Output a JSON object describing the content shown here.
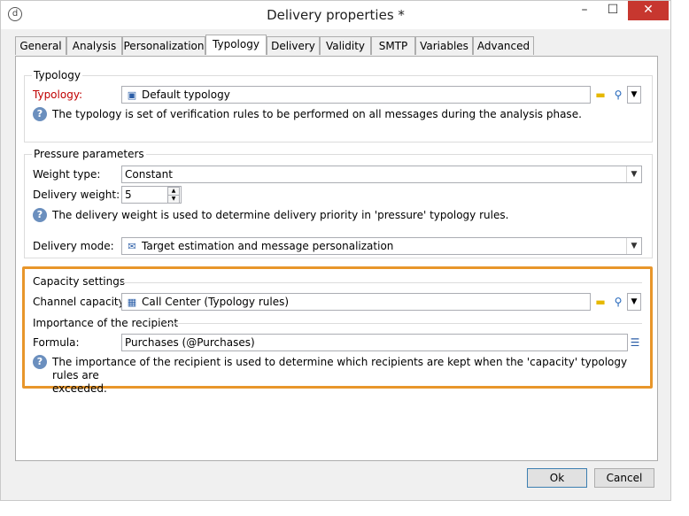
{
  "window": {
    "title": "Delivery properties *",
    "app_icon": "d",
    "min_glyph": "–",
    "max_glyph": "☐",
    "close_glyph": "✕"
  },
  "tabs": [
    {
      "label": "General"
    },
    {
      "label": "Analysis"
    },
    {
      "label": "Personalization"
    },
    {
      "label": "Typology",
      "active": true
    },
    {
      "label": "Delivery"
    },
    {
      "label": "Validity"
    },
    {
      "label": "SMTP"
    },
    {
      "label": "Variables"
    },
    {
      "label": "Advanced"
    }
  ],
  "typology_group": {
    "title": "Typology",
    "label": "Typology:",
    "value": "Default typology",
    "help": "The typology is set of verification rules to be performed on all messages during the analysis phase."
  },
  "pressure_group": {
    "title": "Pressure parameters",
    "weight_type_label": "Weight type:",
    "weight_type_value": "Constant",
    "delivery_weight_label": "Delivery weight:",
    "delivery_weight_value": "5",
    "help": "The delivery weight is used to determine delivery priority in 'pressure' typology rules.",
    "delivery_mode_label": "Delivery mode:",
    "delivery_mode_value": "Target estimation and message personalization"
  },
  "capacity_group": {
    "title": "Capacity settings",
    "channel_label": "Channel capacity:",
    "channel_value": "Call Center (Typology rules)",
    "importance_title": "Importance of the recipient",
    "formula_label": "Formula:",
    "formula_value": "Purchases (@Purchases)",
    "help_line1": "The importance of the recipient is used to determine which recipients are kept when the 'capacity' typology rules are",
    "help_line2": "exceeded."
  },
  "buttons": {
    "ok": "Ok",
    "cancel": "Cancel"
  },
  "icons": {
    "help": "?",
    "folder": "▬",
    "search": "⚲",
    "dropdown": "▼",
    "spin_up": "▲",
    "spin_down": "▼",
    "edit": "☰"
  },
  "colors": {
    "highlight": "#e8962b",
    "required_label": "#c00000",
    "close_button": "#c7372f"
  }
}
